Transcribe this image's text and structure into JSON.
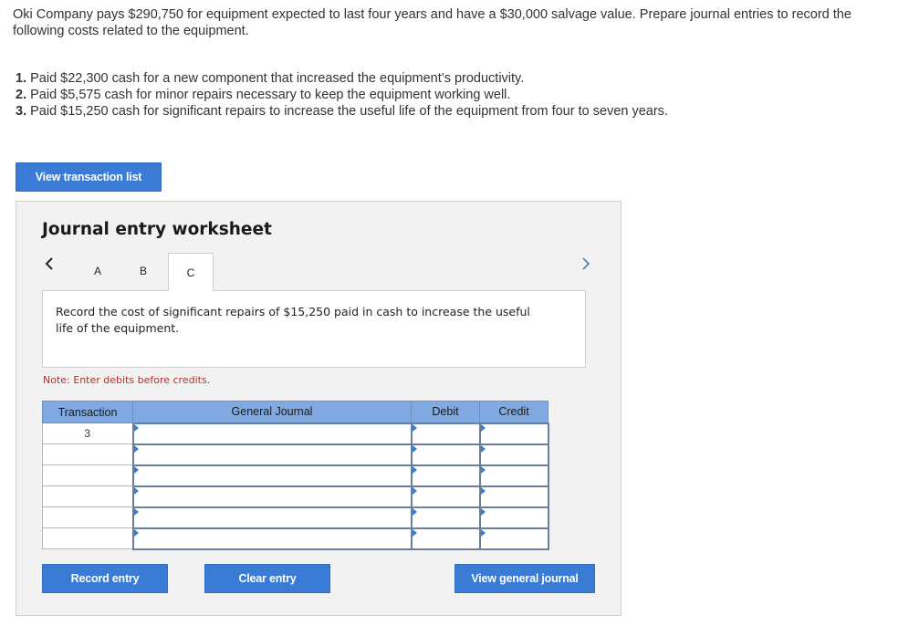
{
  "problem": {
    "intro": "Oki Company pays $290,750 for equipment expected to last four years and have a $30,000 salvage value. Prepare journal entries to record the following costs related to the equipment.",
    "steps": [
      {
        "num": "1.",
        "text": "Paid $22,300 cash for a new component that increased the equipment’s productivity."
      },
      {
        "num": "2.",
        "text": "Paid $5,575 cash for minor repairs necessary to keep the equipment working well."
      },
      {
        "num": "3.",
        "text": "Paid $15,250 cash for significant repairs to increase the useful life of the equipment from four to seven years."
      }
    ]
  },
  "buttons": {
    "view_transaction_list": "View transaction list",
    "record_entry": "Record entry",
    "clear_entry": "Clear entry",
    "view_general_journal": "View general journal"
  },
  "worksheet": {
    "title": "Journal entry worksheet",
    "tabs": [
      "A",
      "B",
      "C"
    ],
    "active_tab": "C",
    "description": "Record the cost of significant repairs of $15,250 paid in cash to increase the useful life of the equipment.",
    "note": "Note: Enter debits before credits.",
    "table": {
      "headers": [
        "Transaction",
        "General Journal",
        "Debit",
        "Credit"
      ],
      "rows": [
        {
          "transaction": "3",
          "account": "",
          "debit": "",
          "credit": ""
        },
        {
          "transaction": "",
          "account": "",
          "debit": "",
          "credit": ""
        },
        {
          "transaction": "",
          "account": "",
          "debit": "",
          "credit": ""
        },
        {
          "transaction": "",
          "account": "",
          "debit": "",
          "credit": ""
        },
        {
          "transaction": "",
          "account": "",
          "debit": "",
          "credit": ""
        },
        {
          "transaction": "",
          "account": "",
          "debit": "",
          "credit": ""
        }
      ]
    }
  },
  "icons": {
    "prev": "chevron-left-icon",
    "next": "chevron-right-icon"
  },
  "colors": {
    "button_blue": "#3a7bd5",
    "header_blue": "#7fa9e0",
    "note_red": "#aa3333"
  }
}
